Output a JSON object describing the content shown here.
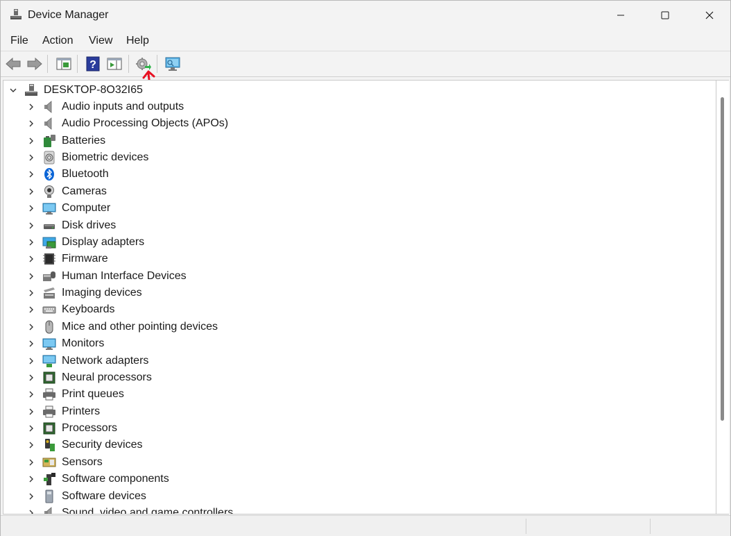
{
  "window": {
    "title": "Device Manager",
    "icon": "device-manager-icon"
  },
  "menu": {
    "items": [
      "File",
      "Action",
      "View",
      "Help"
    ]
  },
  "toolbar": {
    "buttons": [
      {
        "name": "back-button",
        "icon": "back-arrow-icon"
      },
      {
        "name": "forward-button",
        "icon": "forward-arrow-icon"
      },
      {
        "name": "show-hide-console-tree-button",
        "icon": "console-tree-icon"
      },
      {
        "name": "help-button",
        "icon": "help-icon"
      },
      {
        "name": "show-action-pane-button",
        "icon": "action-pane-icon"
      },
      {
        "name": "add-legacy-hardware-button",
        "icon": "gear-add-icon"
      },
      {
        "name": "scan-hardware-changes-button",
        "icon": "monitor-scan-icon"
      }
    ],
    "annotation_color": "#e81123"
  },
  "tree": {
    "root": {
      "label": "DESKTOP-8O32I65",
      "expanded": true,
      "icon": "computer-tower-icon"
    },
    "categories": [
      {
        "label": "Audio inputs and outputs",
        "icon": "speaker-icon"
      },
      {
        "label": "Audio Processing Objects (APOs)",
        "icon": "speaker-icon"
      },
      {
        "label": "Batteries",
        "icon": "battery-icon"
      },
      {
        "label": "Biometric devices",
        "icon": "fingerprint-icon"
      },
      {
        "label": "Bluetooth",
        "icon": "bluetooth-icon"
      },
      {
        "label": "Cameras",
        "icon": "camera-icon"
      },
      {
        "label": "Computer",
        "icon": "monitor-icon"
      },
      {
        "label": "Disk drives",
        "icon": "disk-drive-icon"
      },
      {
        "label": "Display adapters",
        "icon": "display-adapter-icon"
      },
      {
        "label": "Firmware",
        "icon": "chip-icon"
      },
      {
        "label": "Human Interface Devices",
        "icon": "hid-icon"
      },
      {
        "label": "Imaging devices",
        "icon": "scanner-icon"
      },
      {
        "label": "Keyboards",
        "icon": "keyboard-icon"
      },
      {
        "label": "Mice and other pointing devices",
        "icon": "mouse-icon"
      },
      {
        "label": "Monitors",
        "icon": "monitor-icon"
      },
      {
        "label": "Network adapters",
        "icon": "network-icon"
      },
      {
        "label": "Neural processors",
        "icon": "processor-icon"
      },
      {
        "label": "Print queues",
        "icon": "printer-icon"
      },
      {
        "label": "Printers",
        "icon": "printer-icon"
      },
      {
        "label": "Processors",
        "icon": "processor-icon"
      },
      {
        "label": "Security devices",
        "icon": "security-key-icon"
      },
      {
        "label": "Sensors",
        "icon": "sensor-icon"
      },
      {
        "label": "Software components",
        "icon": "software-component-icon"
      },
      {
        "label": "Software devices",
        "icon": "software-device-icon"
      },
      {
        "label": "Sound, video and game controllers",
        "icon": "speaker-icon"
      }
    ]
  },
  "colors": {
    "accent_blue": "#1f6fd6",
    "bluetooth": "#0a64d6"
  }
}
